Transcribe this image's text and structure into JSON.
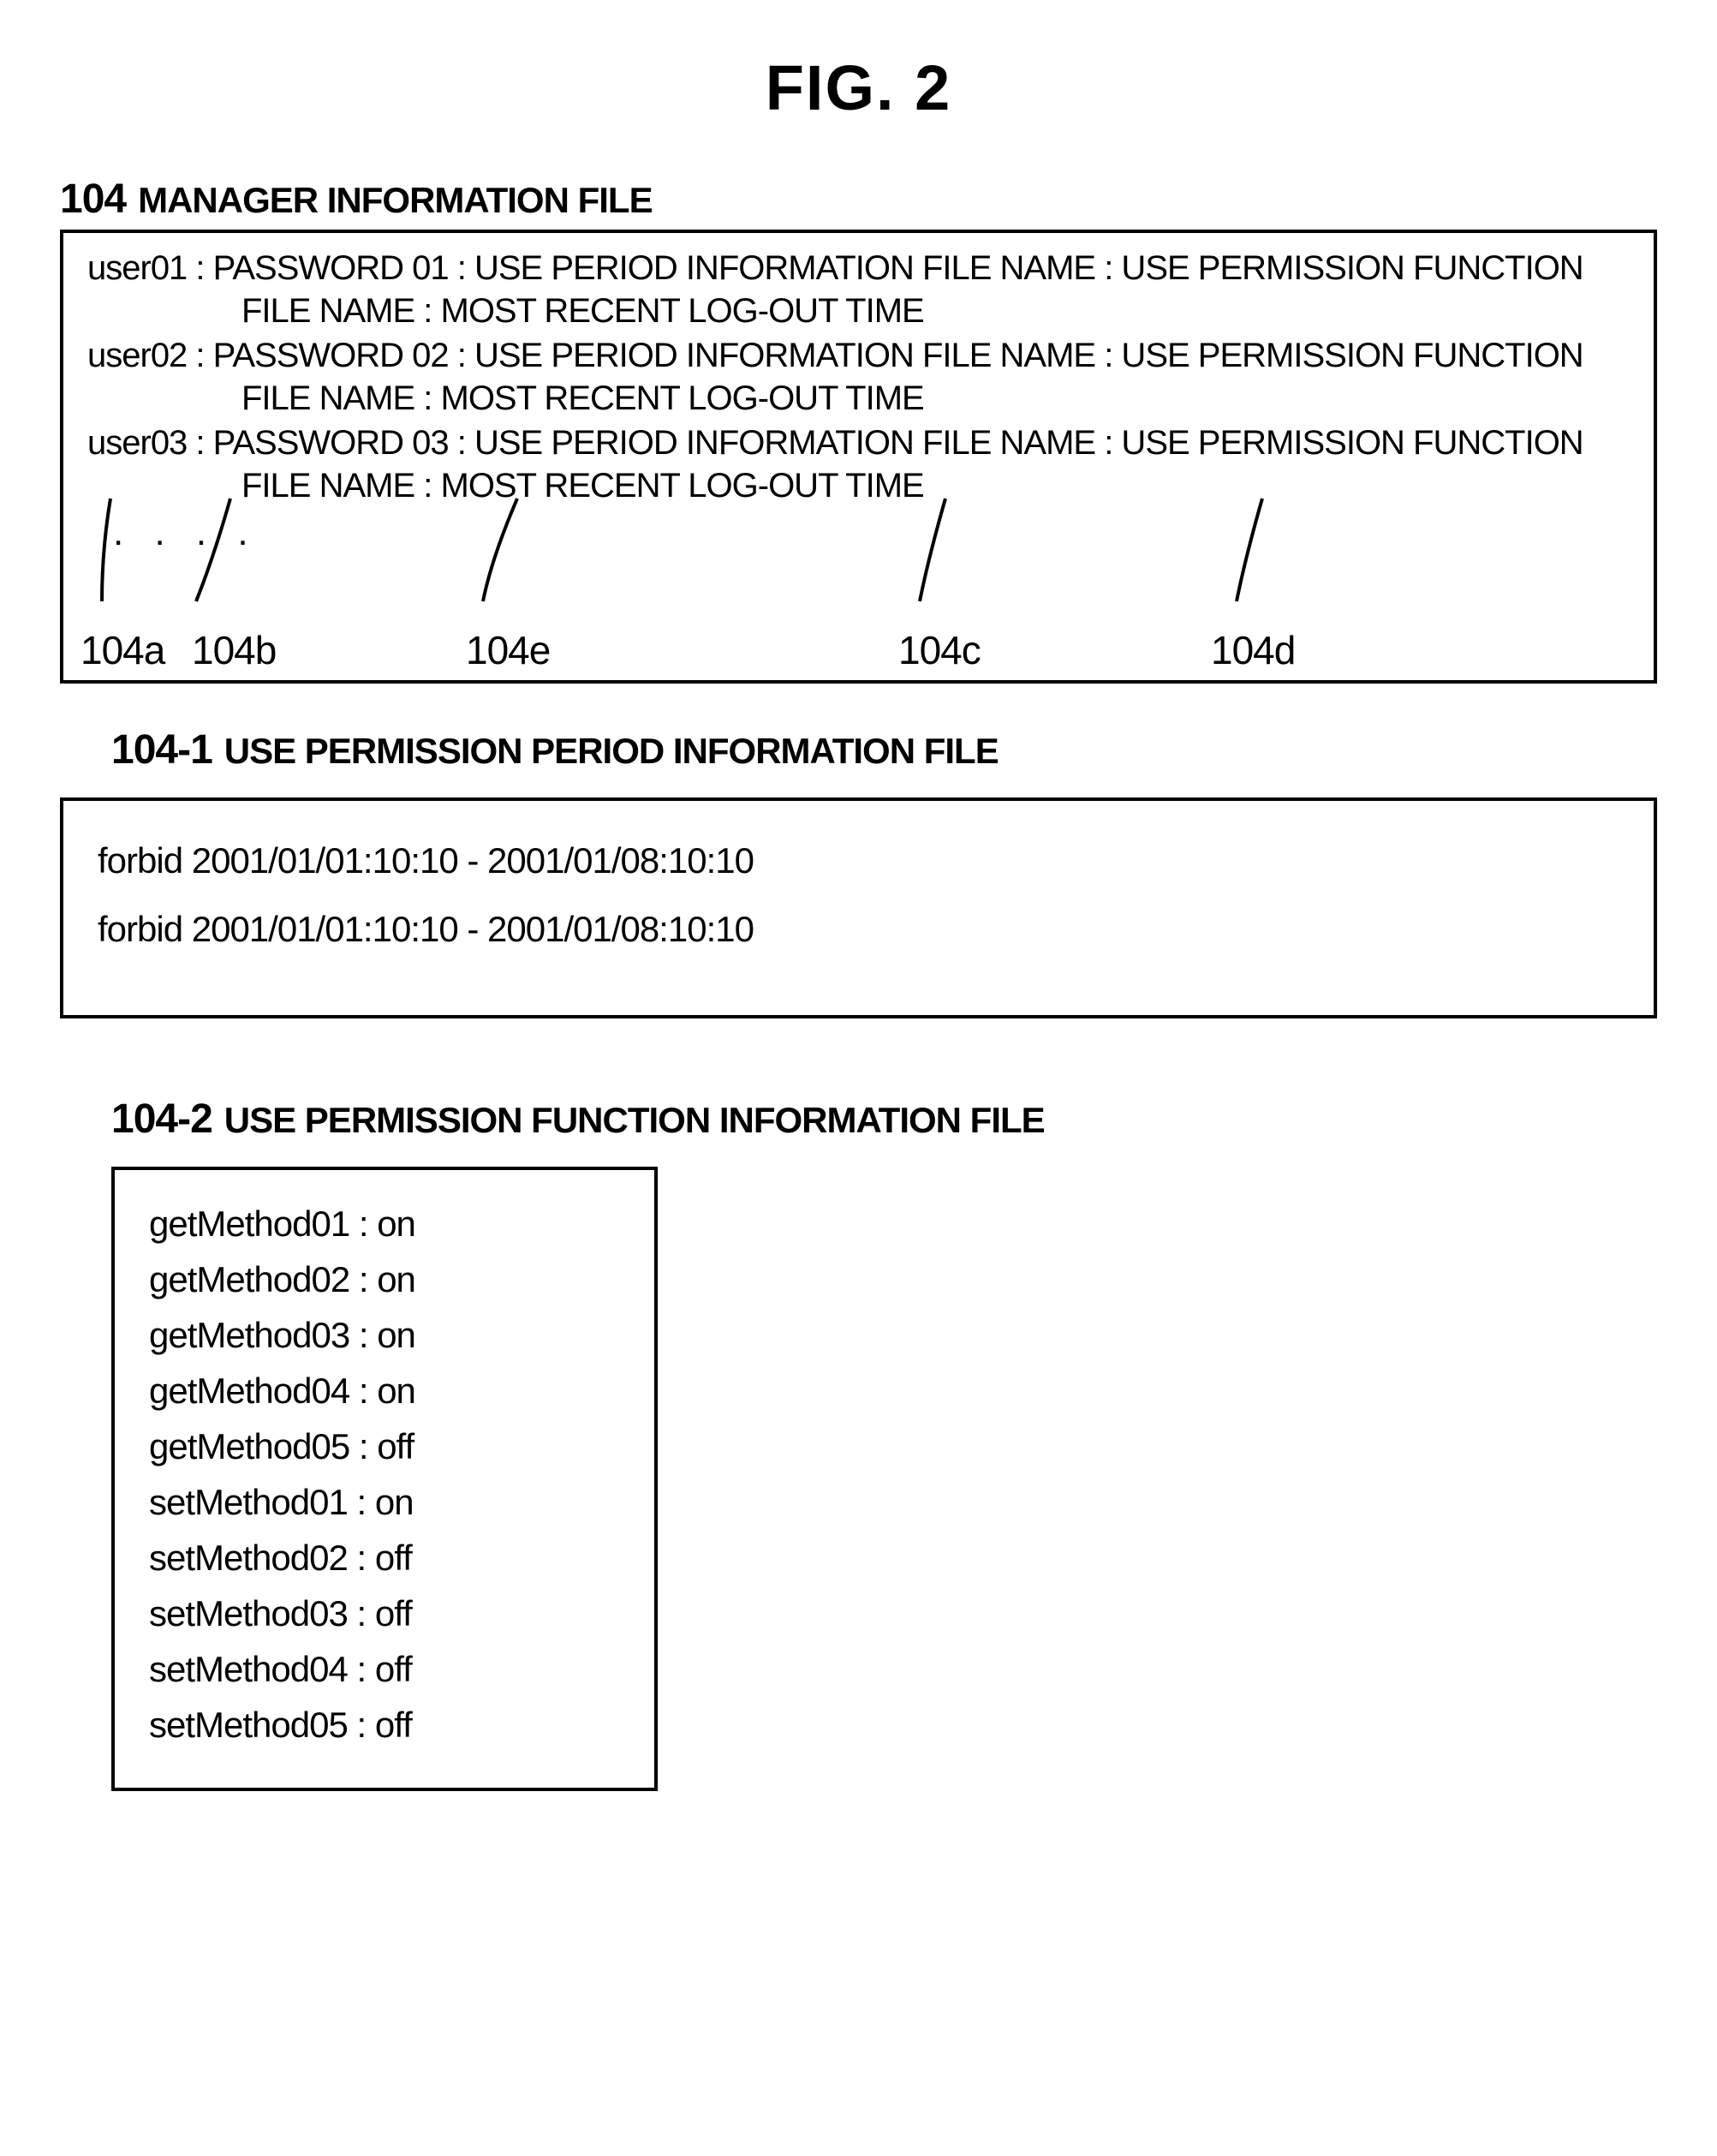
{
  "figure_title": "FIG. 2",
  "section104": {
    "num": "104",
    "title": "MANAGER INFORMATION FILE",
    "entries": [
      {
        "line1": "user01 : PASSWORD 01 : USE PERIOD INFORMATION FILE NAME : USE PERMISSION FUNCTION",
        "line2": "FILE NAME : MOST RECENT LOG-OUT TIME"
      },
      {
        "line1": "user02 : PASSWORD 02 : USE PERIOD INFORMATION FILE NAME : USE PERMISSION FUNCTION",
        "line2": "FILE NAME : MOST RECENT LOG-OUT TIME"
      },
      {
        "line1": "user03 : PASSWORD 03 : USE PERIOD INFORMATION FILE NAME : USE PERMISSION FUNCTION",
        "line2": "FILE NAME : MOST RECENT LOG-OUT TIME"
      }
    ],
    "ellipsis": ". . . .",
    "refs": {
      "a": "104a",
      "b": "104b",
      "e": "104e",
      "c": "104c",
      "d": "104d"
    }
  },
  "section1041": {
    "num": "104-1",
    "title": "USE PERMISSION PERIOD INFORMATION FILE",
    "lines": [
      "forbid  2001/01/01:10:10   -   2001/01/08:10:10",
      "forbid  2001/01/01:10:10   -   2001/01/08:10:10"
    ]
  },
  "section1042": {
    "num": "104-2",
    "title": "USE PERMISSION FUNCTION INFORMATION FILE",
    "lines": [
      "getMethod01 : on",
      "getMethod02 : on",
      "getMethod03 : on",
      "getMethod04 : on",
      "getMethod05 : off",
      "setMethod01 : on",
      "setMethod02 : off",
      "setMethod03 : off",
      "setMethod04 : off",
      "setMethod05 : off"
    ]
  }
}
